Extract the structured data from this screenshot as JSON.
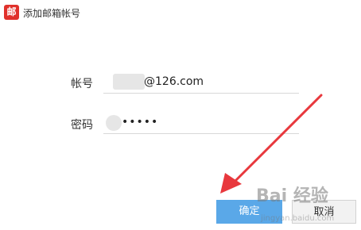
{
  "window": {
    "icon_glyph": "邮",
    "title": "添加邮箱帐号"
  },
  "form": {
    "account_label": "帐号",
    "account_value": "@126.com",
    "password_label": "密码",
    "password_value": "•••••"
  },
  "buttons": {
    "ok_label": "确定",
    "cancel_label": "取消"
  },
  "watermark": {
    "text": "Bai 经验",
    "sub": "jingyan.baidu.com"
  },
  "colors": {
    "accent": "#5aa8e8",
    "icon_red": "#e0312b",
    "arrow_red": "#e8383d"
  }
}
